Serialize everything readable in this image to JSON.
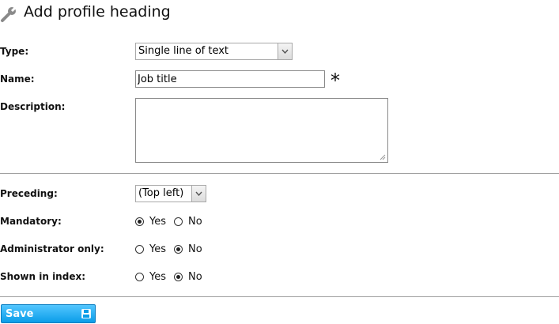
{
  "header": {
    "title": "Add profile heading",
    "icon": "wrench-icon"
  },
  "form": {
    "type": {
      "label": "Type:",
      "value": "Single line of text"
    },
    "name": {
      "label": "Name:",
      "value": "Job title",
      "required_mark": "*"
    },
    "description": {
      "label": "Description:",
      "value": ""
    },
    "preceding": {
      "label": "Preceding:",
      "value": "(Top left)"
    },
    "mandatory": {
      "label": "Mandatory:",
      "yes": "Yes",
      "no": "No",
      "selected": "Yes"
    },
    "admin_only": {
      "label": "Administrator only:",
      "yes": "Yes",
      "no": "No",
      "selected": "No"
    },
    "shown_in_index": {
      "label": "Shown in index:",
      "yes": "Yes",
      "no": "No",
      "selected": "No"
    }
  },
  "actions": {
    "save_label": "Save",
    "save_icon": "disk-icon"
  },
  "colors": {
    "save_button_top": "#53c6ff",
    "save_button_bottom": "#0a9de8"
  }
}
